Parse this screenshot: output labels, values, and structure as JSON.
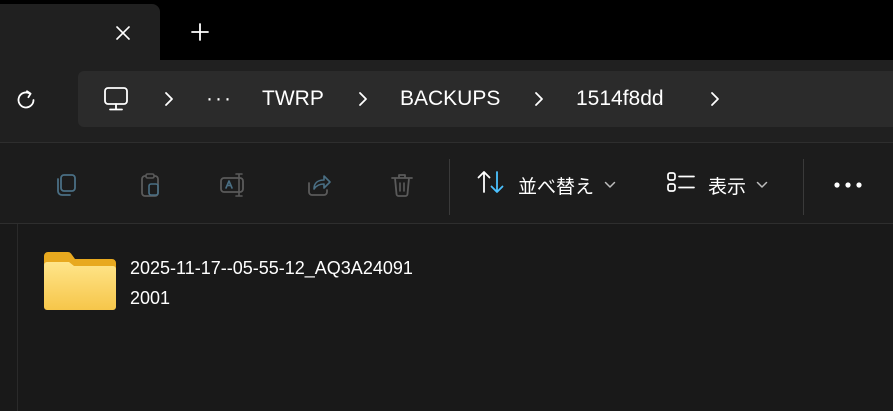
{
  "tabs": {
    "close_icon": "close-icon",
    "new_tab_icon": "plus-icon"
  },
  "nav": {
    "refresh_icon": "refresh-icon",
    "breadcrumb": {
      "root_icon": "this-pc-icon",
      "overflow_label": "···",
      "items": [
        "TWRP",
        "BACKUPS",
        "1514f8dd"
      ]
    }
  },
  "toolbar": {
    "icons": [
      "copy-icon",
      "paste-icon",
      "rename-icon",
      "share-icon",
      "delete-icon"
    ],
    "sort_label": "並べ替え",
    "view_label": "表示",
    "more_icon": "more-icon"
  },
  "files": [
    {
      "name_line1": "2025-11-17--05-55-12_AQ3A24091",
      "name_line2": "2001",
      "icon": "folder-icon"
    }
  ],
  "colors": {
    "tab_strip": "#000000",
    "chrome": "#202020",
    "address_bar": "#2b2b2b",
    "content": "#191919",
    "accent_sort": "#4cc2ff",
    "folder_yellow": "#f8cf5c"
  }
}
